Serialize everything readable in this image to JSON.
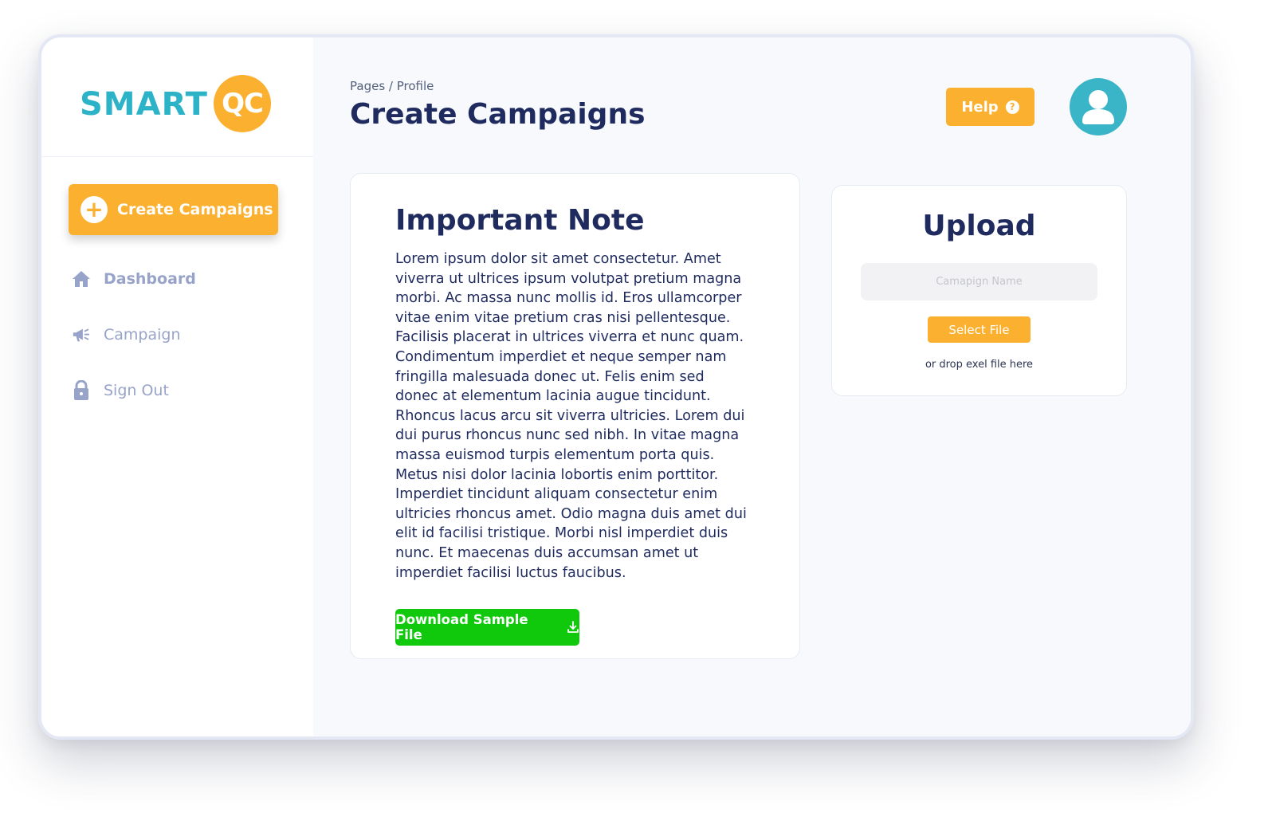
{
  "logo": {
    "text": "SMART",
    "badge": "QC"
  },
  "sidebar": {
    "create_label": "Create Campaigns",
    "items": [
      {
        "label": "Dashboard",
        "icon": "home-icon"
      },
      {
        "label": "Campaign",
        "icon": "megaphone-icon"
      },
      {
        "label": "Sign Out",
        "icon": "lock-icon"
      }
    ]
  },
  "header": {
    "breadcrumb": "Pages / Profile",
    "title": "Create Campaigns",
    "help_label": "Help",
    "help_icon": "question-icon"
  },
  "note": {
    "title": "Important Note",
    "body": "Lorem ipsum dolor sit amet consectetur. Amet viverra ut ultrices ipsum volutpat pretium magna morbi. Ac massa nunc mollis id. Eros ullamcorper vitae enim vitae pretium cras nisi pellentesque. Facilisis placerat in ultrices viverra et nunc quam. Condimentum imperdiet et neque semper nam fringilla malesuada donec ut. Felis enim sed donec at elementum lacinia augue tincidunt. Rhoncus lacus arcu sit viverra ultricies. Lorem dui dui purus rhoncus nunc sed nibh. In vitae magna massa euismod turpis elementum porta quis. Metus nisi dolor lacinia lobortis enim porttitor. Imperdiet tincidunt aliquam consectetur enim ultricies rhoncus amet. Odio magna duis amet dui elit id facilisi tristique. Morbi nisl imperdiet duis nunc. Et maecenas duis accumsan amet ut imperdiet facilisi luctus faucibus.",
    "download_label": "Download Sample File"
  },
  "upload": {
    "title": "Upload",
    "input_placeholder": "Camapign Name",
    "input_value": "",
    "select_label": "Select File",
    "drop_hint": "or drop exel file here"
  },
  "colors": {
    "accent": "#fbb12f",
    "brand_teal": "#2db3c8",
    "navy": "#1f2b5e",
    "nav_muted": "#98a3c9",
    "download_green": "#10c90d",
    "avatar_bg": "#3ab4c7"
  }
}
